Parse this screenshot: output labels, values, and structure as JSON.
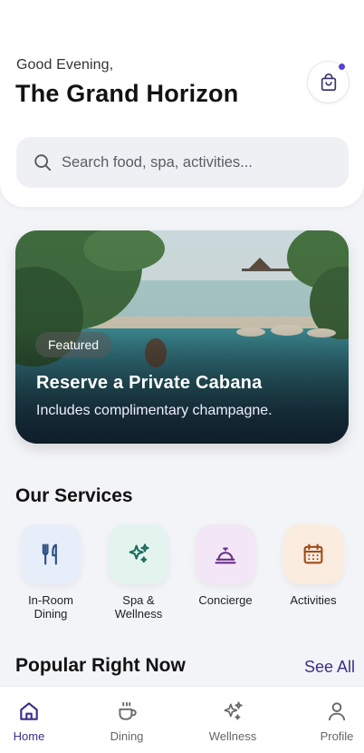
{
  "header": {
    "greeting": "Good Evening,",
    "hotel_name": "The Grand Horizon",
    "cart_icon": "shopping-bag-icon",
    "cart_has_notification": true
  },
  "search": {
    "placeholder": "Search food, spa, activities..."
  },
  "featured": {
    "badge": "Featured",
    "title": "Reserve a Private Cabana",
    "subtitle": "Includes complimentary champagne."
  },
  "services": {
    "title": "Our Services",
    "items": [
      {
        "label": "In-Room\nDining",
        "icon": "utensils-icon",
        "color": "#e6eef9"
      },
      {
        "label": "Spa &\nWellness",
        "icon": "sparkle-icon",
        "color": "#e3f4ef"
      },
      {
        "label": "Concierge",
        "icon": "service-bell-icon",
        "color": "#f3e7f7"
      },
      {
        "label": "Activities",
        "icon": "calendar-icon",
        "color": "#fbece0"
      }
    ]
  },
  "popular": {
    "title": "Popular Right Now",
    "see_all": "See All"
  },
  "tabs": [
    {
      "label": "Home",
      "icon": "home-icon",
      "active": true
    },
    {
      "label": "Dining",
      "icon": "coffee-cup-icon",
      "active": false
    },
    {
      "label": "Wellness",
      "icon": "sparkle-icon",
      "active": false
    },
    {
      "label": "Profile",
      "icon": "user-icon",
      "active": false
    }
  ],
  "colors": {
    "accent": "#3c2f8c",
    "notification_dot": "#5a3fd6",
    "background": "#f3f4f7"
  }
}
